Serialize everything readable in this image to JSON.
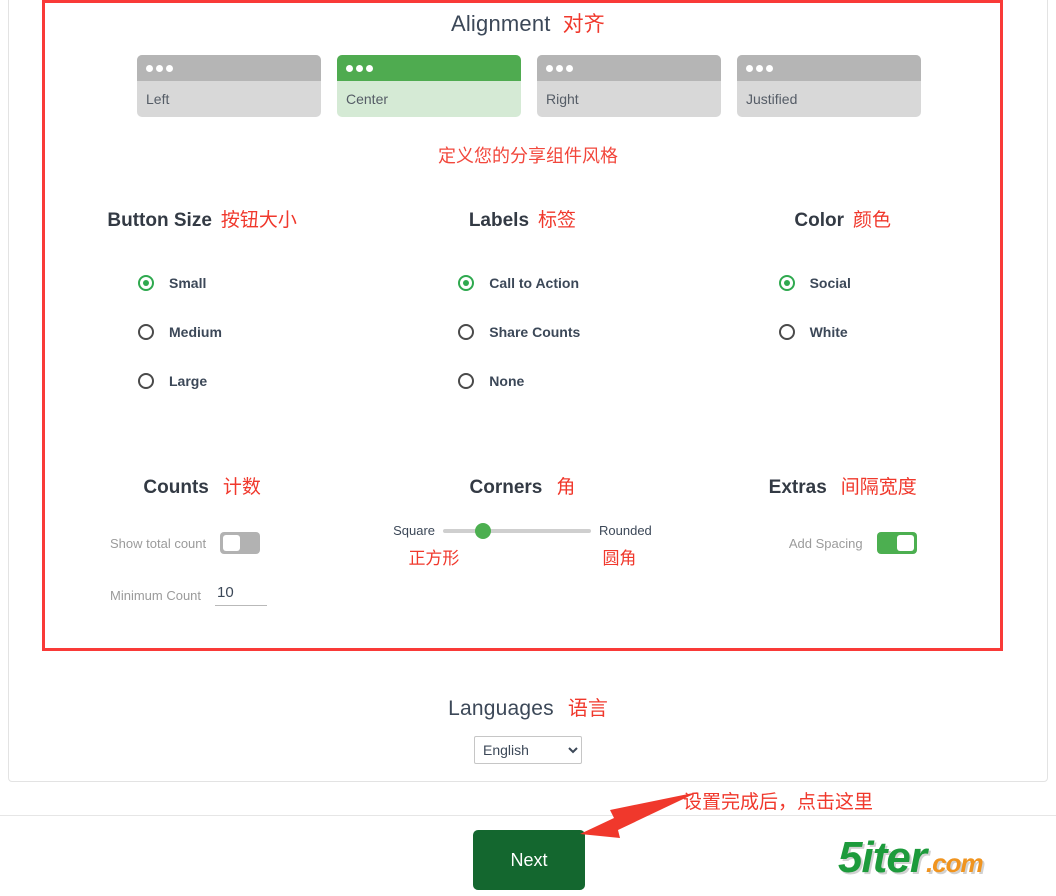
{
  "alignment": {
    "title": "Alignment",
    "title_cn": "对齐",
    "options": [
      {
        "label": "Left",
        "selected": false
      },
      {
        "label": "Center",
        "selected": true
      },
      {
        "label": "Right",
        "selected": false
      },
      {
        "label": "Justified",
        "selected": false
      }
    ]
  },
  "caption": "定义您的分享组件风格",
  "button_size": {
    "title": "Button Size",
    "title_cn": "按钮大小",
    "options": [
      {
        "label": "Small",
        "selected": true
      },
      {
        "label": "Medium",
        "selected": false
      },
      {
        "label": "Large",
        "selected": false
      }
    ]
  },
  "labels": {
    "title": "Labels",
    "title_cn": "标签",
    "options": [
      {
        "label": "Call to Action",
        "selected": true
      },
      {
        "label": "Share Counts",
        "selected": false
      },
      {
        "label": "None",
        "selected": false
      }
    ]
  },
  "color": {
    "title": "Color",
    "title_cn": "颜色",
    "options": [
      {
        "label": "Social",
        "selected": true
      },
      {
        "label": "White",
        "selected": false
      }
    ]
  },
  "counts": {
    "title": "Counts",
    "title_cn": "计数",
    "show_total_label": "Show total count",
    "show_total_on": false,
    "minimum_label": "Minimum Count",
    "minimum_value": "10"
  },
  "corners": {
    "title": "Corners",
    "title_cn": "角",
    "left_label": "Square",
    "left_label_cn": "正方形",
    "right_label": "Rounded",
    "right_label_cn": "圆角",
    "value_percent": 27
  },
  "extras": {
    "title": "Extras",
    "title_cn": "间隔宽度",
    "add_spacing_label": "Add Spacing",
    "add_spacing_on": true
  },
  "languages": {
    "title": "Languages",
    "title_cn": "语言",
    "selected": "English",
    "options": [
      "English"
    ]
  },
  "footer": {
    "next_label": "Next",
    "annotation": "设置完成后，点击这里"
  },
  "watermark": {
    "main": "5iter",
    "suffix": ".com"
  },
  "colors": {
    "accent_green": "#4caf50",
    "dark_green": "#14667f",
    "annotation_red": "#f0382c",
    "highlight_border": "#f93a38"
  }
}
